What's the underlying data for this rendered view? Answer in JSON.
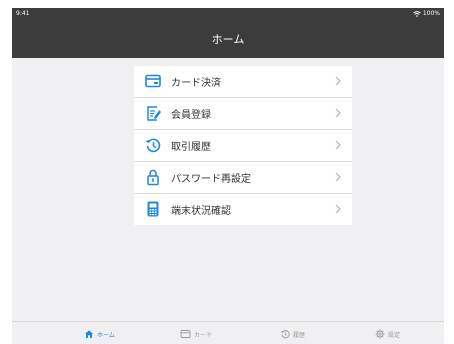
{
  "status_bar": {
    "time": "9:41",
    "battery": "100%"
  },
  "nav": {
    "title": "ホーム"
  },
  "menu": {
    "items": [
      {
        "label": "カード決済",
        "icon": "card-icon"
      },
      {
        "label": "会員登録",
        "icon": "register-icon"
      },
      {
        "label": "取引履歴",
        "icon": "history-icon"
      },
      {
        "label": "パスワード再設定",
        "icon": "lock-icon"
      },
      {
        "label": "端末状況確認",
        "icon": "terminal-icon"
      }
    ]
  },
  "tabs": [
    {
      "label": "ホーム",
      "icon": "home-icon",
      "active": true
    },
    {
      "label": "カード",
      "icon": "card-icon"
    },
    {
      "label": "履歴",
      "icon": "history-icon"
    },
    {
      "label": "設定",
      "icon": "gear-icon"
    }
  ],
  "colors": {
    "accent": "#1e88e5",
    "header": "#3c3c3c",
    "background": "#f0f0f2"
  }
}
